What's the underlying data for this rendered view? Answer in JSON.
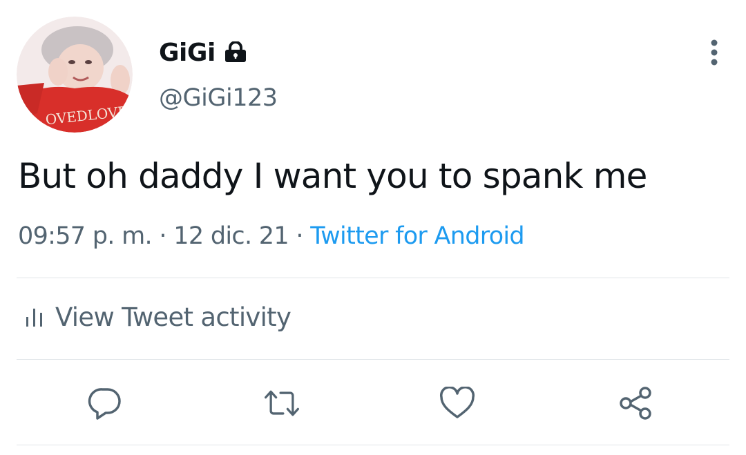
{
  "tweet": {
    "author": {
      "display_name": "GiGi",
      "handle": "@GiGi123",
      "protected_icon": "lock-icon",
      "avatar_shirt_text": "OVEDLOVE"
    },
    "text": "But oh daddy I want you to spank me",
    "time": "09:57 p. m.",
    "separator": "·",
    "date": "12 dic. 21",
    "source": "Twitter for Android"
  },
  "activity": {
    "icon": "bar-chart-icon",
    "label": "View Tweet activity"
  },
  "actions": [
    {
      "name": "reply",
      "icon": "reply-icon"
    },
    {
      "name": "retweet",
      "icon": "retweet-icon"
    },
    {
      "name": "like",
      "icon": "heart-icon"
    },
    {
      "name": "share",
      "icon": "share-icon"
    }
  ],
  "colors": {
    "text": "#0f1419",
    "secondary": "#536471",
    "link": "#1d9bf0",
    "divider": "#dfe4e8"
  }
}
